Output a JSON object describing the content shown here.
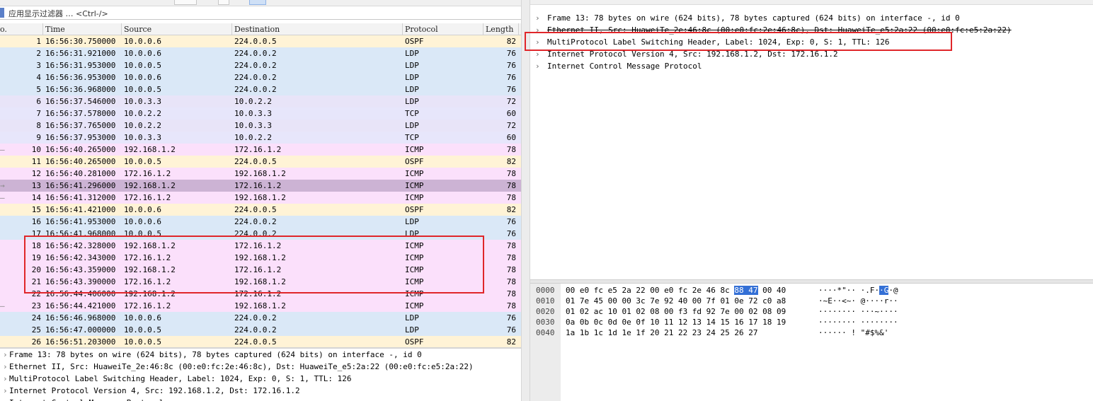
{
  "filter": {
    "placeholder": "应用显示过滤器 … <Ctrl-/>"
  },
  "columns": {
    "no": "o.",
    "time": "Time",
    "source": "Source",
    "destination": "Destination",
    "protocol": "Protocol",
    "length": "Length"
  },
  "packets": [
    {
      "no": "1",
      "time": "16:56:30.750000",
      "src": "10.0.0.6",
      "dst": "224.0.0.5",
      "proto": "OSPF",
      "len": "82",
      "mark": "",
      "cls": "p-ospf"
    },
    {
      "no": "2",
      "time": "16:56:31.921000",
      "src": "10.0.0.6",
      "dst": "224.0.0.2",
      "proto": "LDP",
      "len": "76",
      "mark": "",
      "cls": "p-ldp"
    },
    {
      "no": "3",
      "time": "16:56:31.953000",
      "src": "10.0.0.5",
      "dst": "224.0.0.2",
      "proto": "LDP",
      "len": "76",
      "mark": "",
      "cls": "p-ldp"
    },
    {
      "no": "4",
      "time": "16:56:36.953000",
      "src": "10.0.0.6",
      "dst": "224.0.0.2",
      "proto": "LDP",
      "len": "76",
      "mark": "",
      "cls": "p-ldp"
    },
    {
      "no": "5",
      "time": "16:56:36.968000",
      "src": "10.0.0.5",
      "dst": "224.0.0.2",
      "proto": "LDP",
      "len": "76",
      "mark": "",
      "cls": "p-ldp"
    },
    {
      "no": "6",
      "time": "16:56:37.546000",
      "src": "10.0.3.3",
      "dst": "10.0.2.2",
      "proto": "LDP",
      "len": "72",
      "mark": "",
      "cls": "p-ldp2"
    },
    {
      "no": "7",
      "time": "16:56:37.578000",
      "src": "10.0.2.2",
      "dst": "10.0.3.3",
      "proto": "TCP",
      "len": "60",
      "mark": "",
      "cls": "p-tcp"
    },
    {
      "no": "8",
      "time": "16:56:37.765000",
      "src": "10.0.2.2",
      "dst": "10.0.3.3",
      "proto": "LDP",
      "len": "72",
      "mark": "",
      "cls": "p-ldp2"
    },
    {
      "no": "9",
      "time": "16:56:37.953000",
      "src": "10.0.3.3",
      "dst": "10.0.2.2",
      "proto": "TCP",
      "len": "60",
      "mark": "",
      "cls": "p-tcp"
    },
    {
      "no": "10",
      "time": "16:56:40.265000",
      "src": "192.168.1.2",
      "dst": "172.16.1.2",
      "proto": "ICMP",
      "len": "78",
      "mark": "–",
      "cls": "p-icmp"
    },
    {
      "no": "11",
      "time": "16:56:40.265000",
      "src": "10.0.0.5",
      "dst": "224.0.0.5",
      "proto": "OSPF",
      "len": "82",
      "mark": "",
      "cls": "p-ospf"
    },
    {
      "no": "12",
      "time": "16:56:40.281000",
      "src": "172.16.1.2",
      "dst": "192.168.1.2",
      "proto": "ICMP",
      "len": "78",
      "mark": "",
      "cls": "p-icmp"
    },
    {
      "no": "13",
      "time": "16:56:41.296000",
      "src": "192.168.1.2",
      "dst": "172.16.1.2",
      "proto": "ICMP",
      "len": "78",
      "mark": "→",
      "cls": "p-sel"
    },
    {
      "no": "14",
      "time": "16:56:41.312000",
      "src": "172.16.1.2",
      "dst": "192.168.1.2",
      "proto": "ICMP",
      "len": "78",
      "mark": "–",
      "cls": "p-icmp"
    },
    {
      "no": "15",
      "time": "16:56:41.421000",
      "src": "10.0.0.6",
      "dst": "224.0.0.5",
      "proto": "OSPF",
      "len": "82",
      "mark": "",
      "cls": "p-ospf"
    },
    {
      "no": "16",
      "time": "16:56:41.953000",
      "src": "10.0.0.6",
      "dst": "224.0.0.2",
      "proto": "LDP",
      "len": "76",
      "mark": "",
      "cls": "p-ldp"
    },
    {
      "no": "17",
      "time": "16:56:41.968000",
      "src": "10.0.0.5",
      "dst": "224.0.0.2",
      "proto": "LDP",
      "len": "76",
      "mark": "",
      "cls": "p-ldp"
    },
    {
      "no": "18",
      "time": "16:56:42.328000",
      "src": "192.168.1.2",
      "dst": "172.16.1.2",
      "proto": "ICMP",
      "len": "78",
      "mark": "",
      "cls": "p-icmp"
    },
    {
      "no": "19",
      "time": "16:56:42.343000",
      "src": "172.16.1.2",
      "dst": "192.168.1.2",
      "proto": "ICMP",
      "len": "78",
      "mark": "",
      "cls": "p-icmp"
    },
    {
      "no": "20",
      "time": "16:56:43.359000",
      "src": "192.168.1.2",
      "dst": "172.16.1.2",
      "proto": "ICMP",
      "len": "78",
      "mark": "",
      "cls": "p-icmp"
    },
    {
      "no": "21",
      "time": "16:56:43.390000",
      "src": "172.16.1.2",
      "dst": "192.168.1.2",
      "proto": "ICMP",
      "len": "78",
      "mark": "",
      "cls": "p-icmp"
    },
    {
      "no": "22",
      "time": "16:56:44.406000",
      "src": "192.168.1.2",
      "dst": "172.16.1.2",
      "proto": "ICMP",
      "len": "78",
      "mark": "",
      "cls": "p-icmp"
    },
    {
      "no": "23",
      "time": "16:56:44.421000",
      "src": "172.16.1.2",
      "dst": "192.168.1.2",
      "proto": "ICMP",
      "len": "78",
      "mark": "–",
      "cls": "p-icmp"
    },
    {
      "no": "24",
      "time": "16:56:46.968000",
      "src": "10.0.0.6",
      "dst": "224.0.0.2",
      "proto": "LDP",
      "len": "76",
      "mark": "",
      "cls": "p-ldp"
    },
    {
      "no": "25",
      "time": "16:56:47.000000",
      "src": "10.0.0.5",
      "dst": "224.0.0.2",
      "proto": "LDP",
      "len": "76",
      "mark": "",
      "cls": "p-ldp"
    },
    {
      "no": "26",
      "time": "16:56:51.203000",
      "src": "10.0.0.5",
      "dst": "224.0.0.5",
      "proto": "OSPF",
      "len": "82",
      "mark": "",
      "cls": "p-ospf"
    }
  ],
  "detail_lines": [
    "Frame 13: 78 bytes on wire (624 bits), 78 bytes captured (624 bits) on interface -, id 0",
    "Ethernet II, Src: HuaweiTe_2e:46:8c (00:e0:fc:2e:46:8c), Dst: HuaweiTe_e5:2a:22 (00:e0:fc:e5:2a:22)",
    "MultiProtocol Label Switching Header, Label: 1024, Exp: 0, S: 1, TTL: 126",
    "Internet Protocol Version 4, Src: 192.168.1.2, Dst: 172.16.1.2",
    "Internet Control Message Protocol"
  ],
  "hex_rows": [
    {
      "off": "0000",
      "bytes": [
        {
          "t": "00 e0 fc e5 2a 22 00 e0  fc 2e 46 8c "
        },
        {
          "t": "88 47",
          "h": true
        },
        {
          "t": " 00 40"
        }
      ],
      "ascii": [
        {
          "t": "····*\"·· ·.F·"
        },
        {
          "t": "·G",
          "h": true
        },
        {
          "t": "·@"
        }
      ]
    },
    {
      "off": "0010",
      "bytes": [
        {
          "t": "01 7e 45 00 00 3c 7e 92  40 00 7f 01 0e 72 c0 a8"
        }
      ],
      "ascii": [
        {
          "t": "·~E··<~· @····r··"
        }
      ]
    },
    {
      "off": "0020",
      "bytes": [
        {
          "t": "01 02 ac 10 01 02 08 00  f3 fd 92 7e 00 02 08 09"
        }
      ],
      "ascii": [
        {
          "t": "········ ···~····"
        }
      ]
    },
    {
      "off": "0030",
      "bytes": [
        {
          "t": "0a 0b 0c 0d 0e 0f 10 11  12 13 14 15 16 17 18 19"
        }
      ],
      "ascii": [
        {
          "t": "········ ········"
        }
      ]
    },
    {
      "off": "0040",
      "bytes": [
        {
          "t": "1a 1b 1c 1d 1e 1f 20 21  22 23 24 25 26 27"
        }
      ],
      "ascii": [
        {
          "t": "······ ! \"#$%&'"
        }
      ]
    }
  ],
  "colors": {
    "highlight_box": "#e0262a",
    "selection": "#3470d6"
  }
}
